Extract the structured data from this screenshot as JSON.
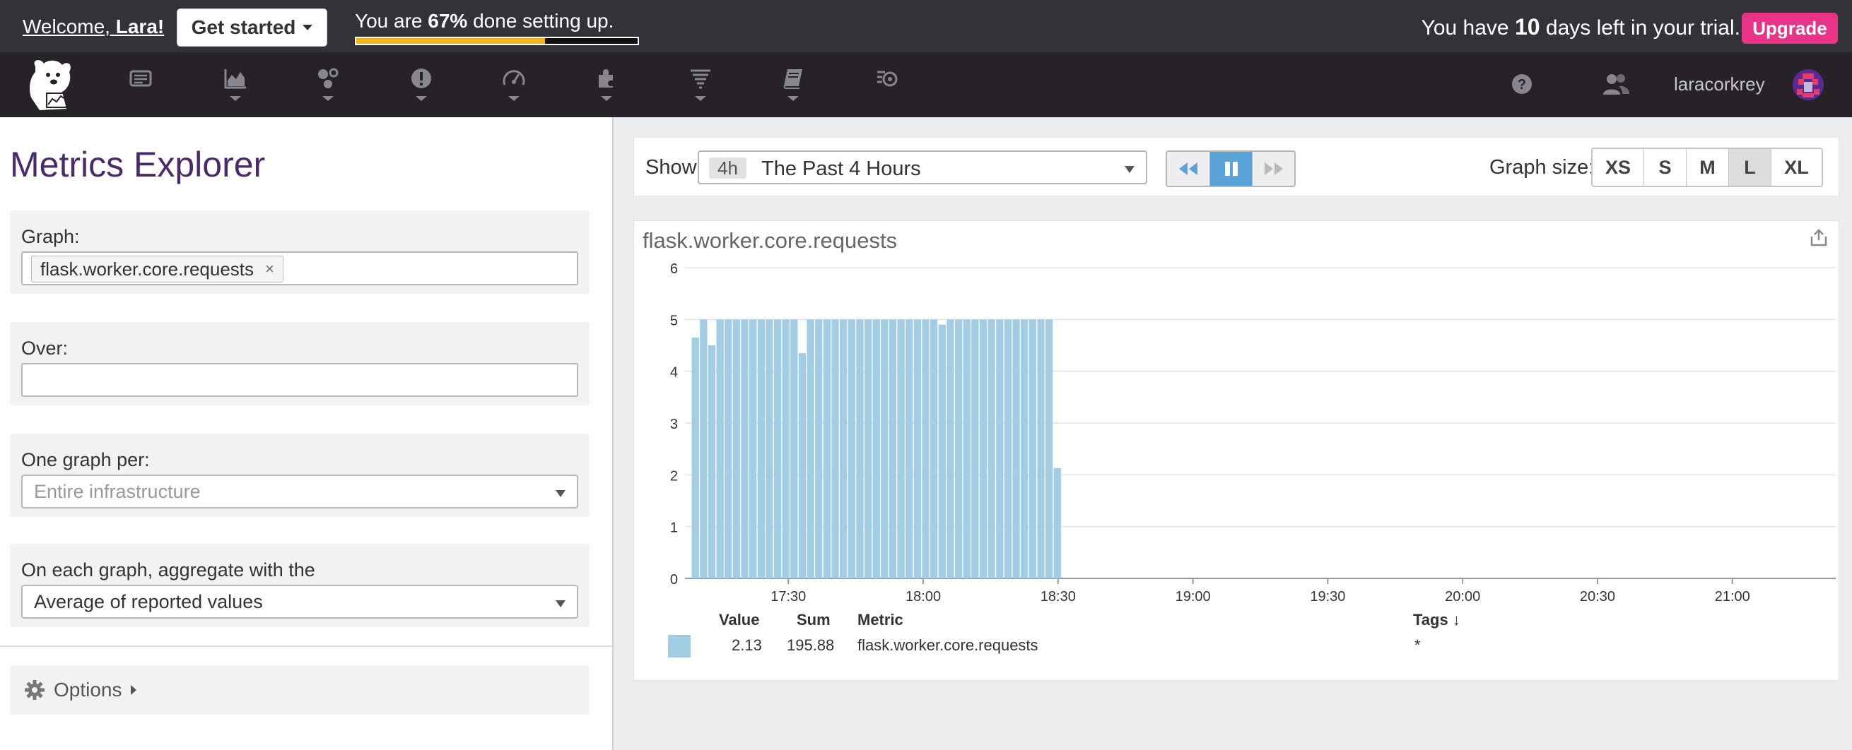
{
  "topbar": {
    "welcome_prefix": "Welcome, ",
    "welcome_name": "Lara!",
    "get_started_label": "Get started",
    "setup_prefix": "You are ",
    "setup_percent": "67%",
    "setup_suffix": " done setting up.",
    "setup_progress": 0.67,
    "trial_prefix": "You have ",
    "trial_days": "10",
    "trial_suffix": " days left in your trial.",
    "upgrade_label": "Upgrade"
  },
  "nav": {
    "icons": [
      "logo-dog-icon",
      "events-icon",
      "dashboards-icon",
      "infrastructure-icon",
      "monitors-icon",
      "apm-icon",
      "integrations-icon",
      "logs-icon",
      "notebooks-icon",
      "synthetics-icon",
      "help-icon",
      "team-icon"
    ],
    "username": "laracorkrey"
  },
  "left": {
    "title": "Metrics Explorer",
    "graph_label": "Graph:",
    "graph_tag": "flask.worker.core.requests",
    "tag_remove": "×",
    "over_label": "Over:",
    "over_value": "",
    "one_graph_per_label": "One graph per:",
    "one_graph_per_placeholder": "Entire infrastructure",
    "aggregate_label": "On each graph, aggregate with the",
    "aggregate_value": "Average of reported values",
    "options_label": "Options"
  },
  "controls": {
    "show_label": "Show",
    "time_badge": "4h",
    "time_text": "The Past 4 Hours",
    "graph_size_label": "Graph size:",
    "sizes": [
      "XS",
      "S",
      "M",
      "L",
      "XL"
    ],
    "active_size": "L"
  },
  "graph": {
    "title": "flask.worker.core.requests",
    "legend_headers": {
      "value": "Value",
      "sum": "Sum",
      "metric": "Metric",
      "tags": "Tags ↓"
    },
    "legend_row": {
      "value": "2.13",
      "sum": "195.88",
      "metric": "flask.worker.core.requests",
      "tags": "*"
    },
    "colors": {
      "bar": "#a2cde4",
      "accent": "#5aa3d8",
      "brand": "#4b2a6a",
      "upgrade": "#e83387",
      "progress": "#f2b51d"
    }
  },
  "chart_data": {
    "type": "bar",
    "y_ticks": [
      0,
      1,
      2,
      3,
      4,
      5,
      6
    ],
    "ylim": [
      0,
      6
    ],
    "x_ticks": [
      "17:30",
      "18:00",
      "18:30",
      "19:00",
      "19:30",
      "20:00",
      "20:30",
      "21:00"
    ],
    "x_tick_minutes": [
      30,
      60,
      90,
      120,
      150,
      180,
      210,
      240
    ],
    "xlim_minutes": [
      7,
      263
    ],
    "bar_width_minutes": 1.62,
    "grid": true,
    "series": [
      {
        "start_minute": 8.5,
        "interval_minutes": 1.83,
        "values": [
          4.65,
          5,
          4.5,
          5,
          5,
          5,
          5,
          5,
          5,
          5,
          5,
          5,
          5,
          4.35,
          5,
          5,
          5,
          5,
          5,
          5,
          5,
          5,
          5,
          5,
          5,
          5,
          5,
          5,
          5,
          5,
          4.9,
          5,
          5,
          5,
          5,
          5,
          5,
          5,
          5,
          5,
          5,
          5,
          5,
          5,
          2.13
        ]
      }
    ]
  }
}
